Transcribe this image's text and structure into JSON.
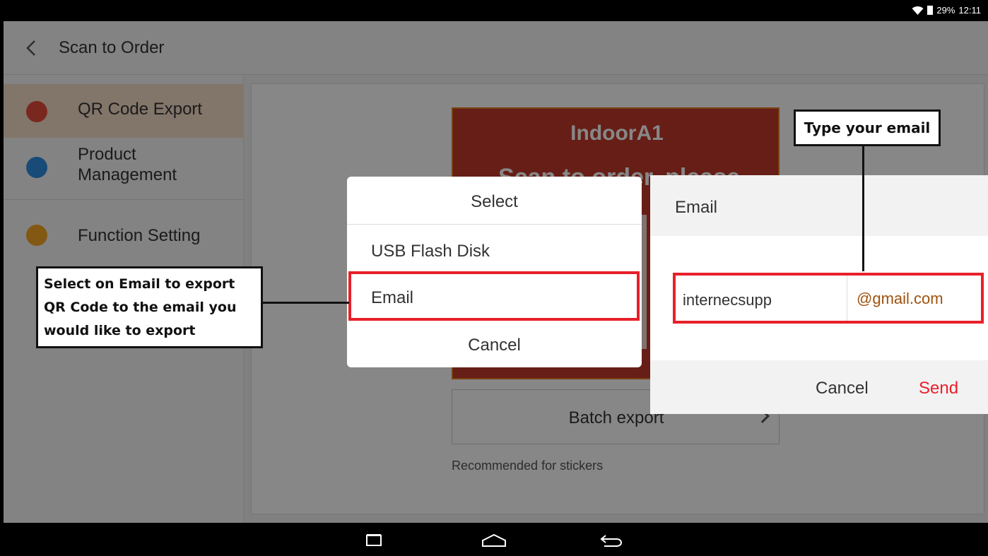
{
  "status_bar": {
    "battery_text": "29%",
    "time": "12:11"
  },
  "header": {
    "title": "Scan to Order"
  },
  "sidebar": {
    "items": [
      {
        "label": "QR Code Export",
        "icon": "qr-code-icon",
        "color": "#e74c3c",
        "active": true
      },
      {
        "label": "Product\nManagement",
        "icon": "box-icon",
        "color": "#2f8fe0",
        "active": false
      },
      {
        "label": "Function Setting",
        "icon": "wrench-icon",
        "color": "#f5a623",
        "active": false
      }
    ]
  },
  "main": {
    "poster_title": "IndoorA1",
    "poster_line": "Scan to order, please",
    "batch_export": "Batch export",
    "recommend": "Recommended for stickers"
  },
  "select_dialog": {
    "title": "Select",
    "options": [
      "USB Flash Disk",
      "Email",
      "Cancel"
    ]
  },
  "email_dialog": {
    "title": "Email",
    "local_part": "internecsupp",
    "domain": "@gmail.com",
    "cancel": "Cancel",
    "send": "Send"
  },
  "annotations": {
    "left": "Select on Email to export QR Code to the email you would like to export",
    "right": "Type your email"
  },
  "colors": {
    "accent": "#e8202a",
    "poster": "#c0392b",
    "domain_text": "#a0520d"
  }
}
